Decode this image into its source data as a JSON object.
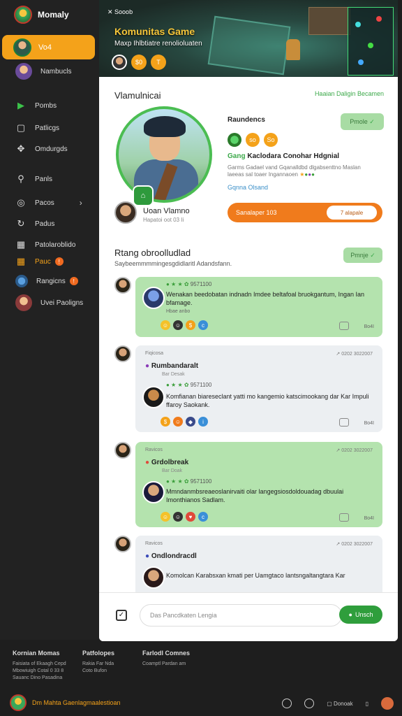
{
  "app": {
    "name": "Momaly"
  },
  "sidebar": {
    "active": {
      "label": "Vo4"
    },
    "items": [
      {
        "label": "Nambucls",
        "icon": "avatar-icon"
      },
      {
        "label": "Pombs",
        "icon": "play-icon"
      },
      {
        "label": "Patlicgs",
        "icon": "document-icon"
      },
      {
        "label": "Omdurgds",
        "icon": "puzzle-icon"
      },
      {
        "label": "Panls",
        "icon": "search-icon"
      },
      {
        "label": "Pacos",
        "icon": "target-icon"
      },
      {
        "label": "Padus",
        "icon": "refresh-icon"
      },
      {
        "label": "Patolaroblido",
        "icon": "grid-icon"
      },
      {
        "label": "Pauc",
        "icon": "grid-icon"
      },
      {
        "label": "Rangicns",
        "icon": "badge-icon"
      },
      {
        "label": "Uvei Paoligns",
        "icon": "avatar-icon"
      }
    ]
  },
  "banner": {
    "back": "Sooob",
    "title": "Komunitas Game",
    "subtitle": "Maxp Ihlbtiatre renolioluaten",
    "icons": [
      "$0",
      "T"
    ]
  },
  "main": {
    "title": "Vlamulnicai",
    "link": "Haaian Daligin Becamen",
    "author": {
      "name": "Uoan Vlamno",
      "sub": "Hapatoi oot 03 Ii"
    },
    "right": {
      "title": "Raundencs",
      "button": "Pmole",
      "icons": [
        "so",
        "So"
      ],
      "head_prefix": "Gang",
      "head": "Kaclodara Conohar Hdgnial",
      "desc": "Garms Gadael vand  Gqanalldbd dlgabsenttno Maslan laeeas sal toaer Ingannaoen",
      "link": "Gqnna Olsand",
      "bar_label": "Sanalaper 103",
      "bar_pill": "7 alapale"
    },
    "section": {
      "title": "Rtang obroolludlad",
      "sub": "Saybeemmmmingesgdidlaritl Adandsfann.",
      "button": "Pmnje"
    },
    "threads": [
      {
        "stats": "9571100",
        "body": "Wenakan beedobatan indnadn Imdee beltafoal bruokgantum, Ingan Ian bfamage.",
        "sub": "Hbae anbo",
        "foot": "Bo4I"
      },
      {
        "top": "Fiqicosa",
        "date": "0202 3022007",
        "name": "Rumbandaralt",
        "name_sub": "Bar Desak",
        "stats": "9571100",
        "body": "Komfianan biareseclant yatti mo kangemio katscimookang dar Kar Impuli ffaroy Saokank.",
        "foot": "Bo4I"
      },
      {
        "top": "Ravicos",
        "date": "0202 3022007",
        "name": "Grdolbreak",
        "name_sub": "Bar Doak",
        "stats": "9571100",
        "body": "Mmndanmbsreaeoslanirvaiti olar langegsiosdoldouadag dbuulai Imonthianos Sadlam.",
        "foot": "Bo4I"
      },
      {
        "top": "Ravicos",
        "date": "0202 3022007",
        "name": "Ondlondracdl",
        "body": "Komolcan Karabsxan kmati per Uamgtaco lantsngaltangtara Kar"
      }
    ]
  },
  "composer": {
    "placeholder": "Das Pancdkaten Lengia",
    "send": "Unsch"
  },
  "footer": {
    "col1": {
      "title": "Kornian Momas",
      "lines": [
        "Faisiata of Ekaagh Cepd",
        "Mbowiuigh Cotal 0 33 8",
        "Sauanc Dino Pasadina"
      ]
    },
    "col2": {
      "title": "Patfolopes",
      "lines": [
        "Rakia Far Nda",
        "Coto Bufon"
      ]
    },
    "col3": {
      "title": "Farlodl Comnes",
      "lines": [
        "Coamptl Pardan am"
      ]
    },
    "brand": "Dm Mahta Gaenlagmaalestioan",
    "right": {
      "field": "Donoak"
    }
  },
  "colors": {
    "accent": "#f4a21a",
    "green": "#3ca94a",
    "orange": "#f07b1c"
  }
}
